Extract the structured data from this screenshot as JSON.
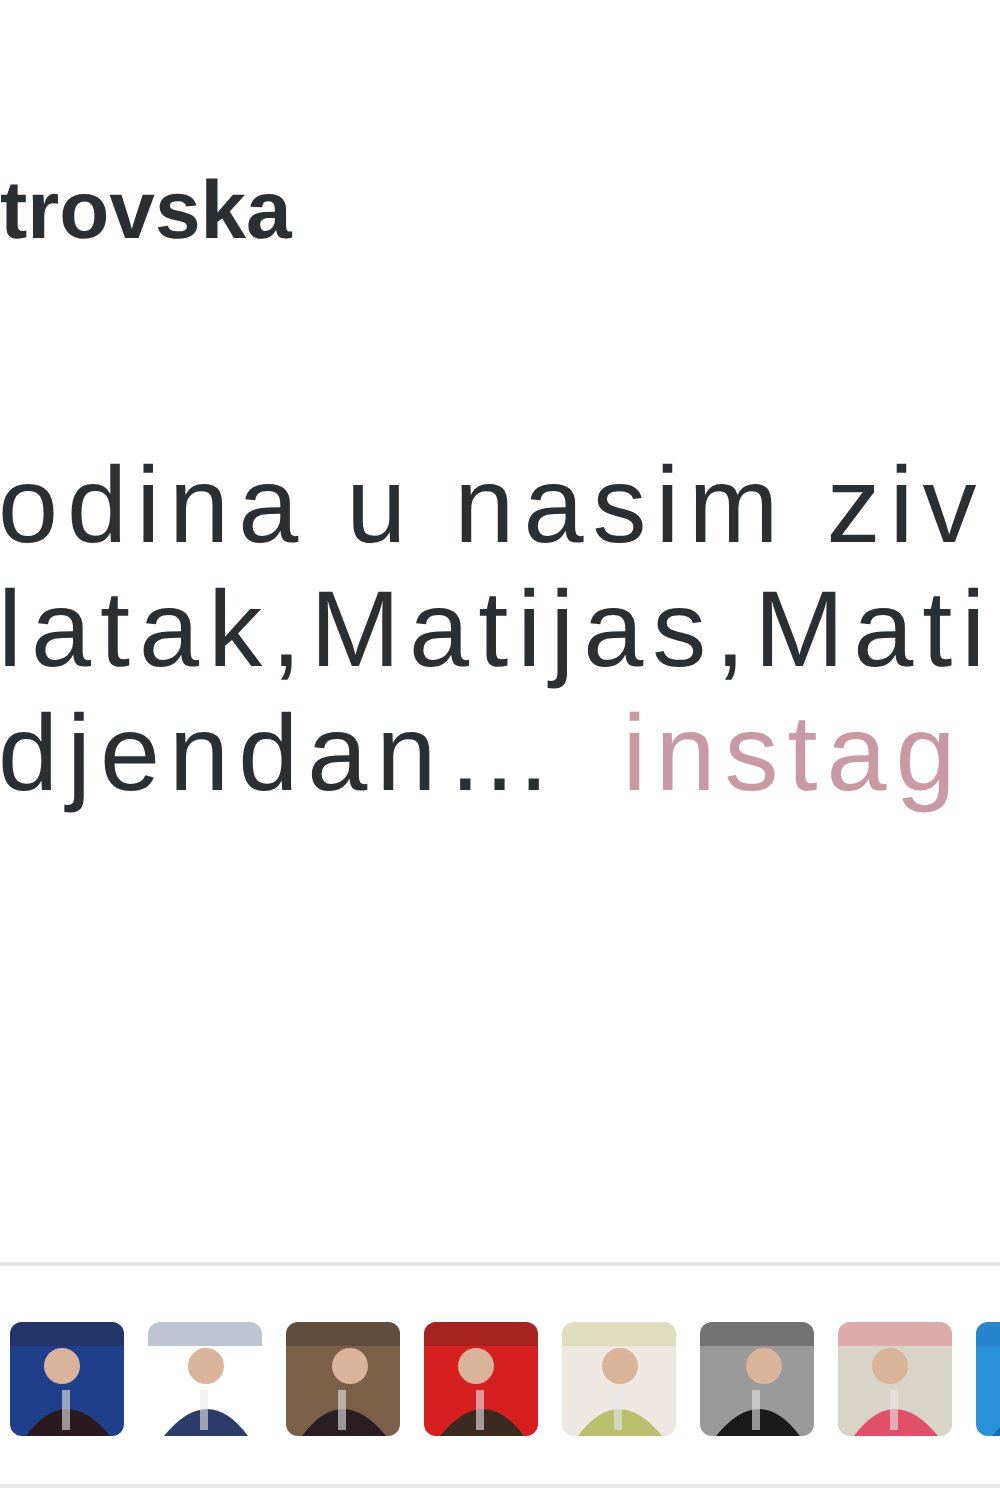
{
  "author": {
    "name": "trovska"
  },
  "tweet": {
    "lines": [
      "odina u nasim ziv",
      "latak,Matijas,Mati",
      "djendan…"
    ],
    "link": "instag"
  }
}
